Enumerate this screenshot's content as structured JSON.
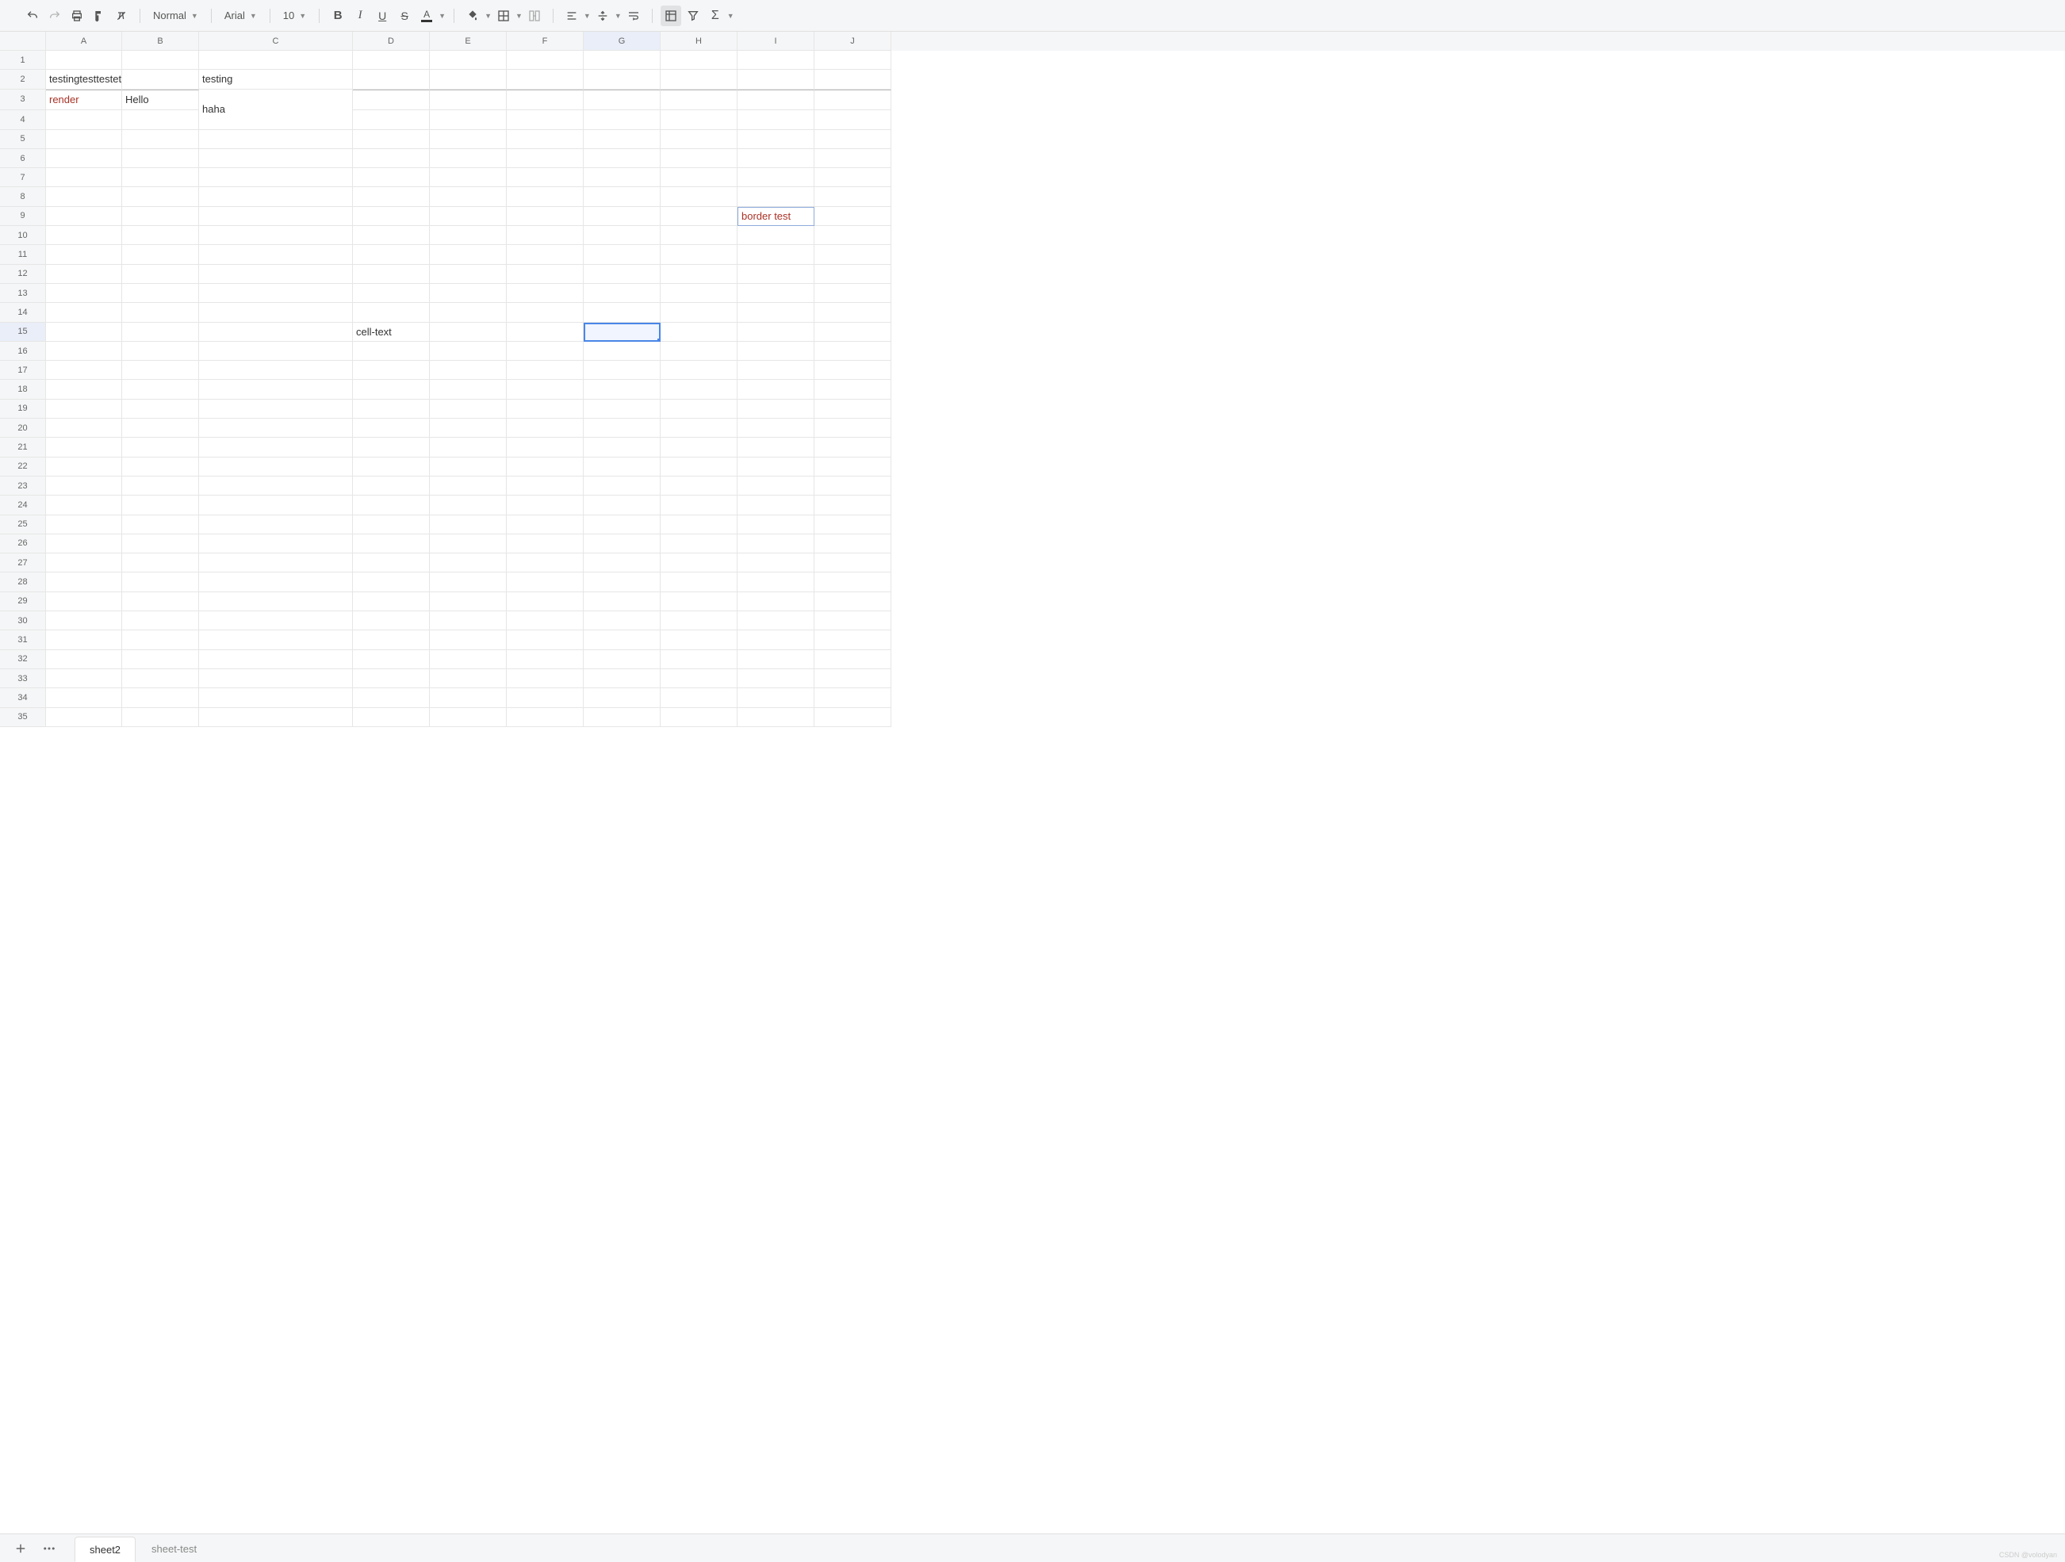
{
  "toolbar": {
    "format_select": "Normal",
    "font_select": "Arial",
    "size_select": "10"
  },
  "columns": [
    {
      "label": "A",
      "width": 96
    },
    {
      "label": "B",
      "width": 97
    },
    {
      "label": "C",
      "width": 194
    },
    {
      "label": "D",
      "width": 97
    },
    {
      "label": "E",
      "width": 97
    },
    {
      "label": "F",
      "width": 97
    },
    {
      "label": "G",
      "width": 97
    },
    {
      "label": "H",
      "width": 97
    },
    {
      "label": "I",
      "width": 97
    },
    {
      "label": "J",
      "width": 97
    }
  ],
  "row_height_default": 24.3,
  "row_heights_override": {
    "3": 26,
    "4": 25
  },
  "num_rows": 35,
  "cells": {
    "A2": {
      "text": "testingtesttestets"
    },
    "C2": {
      "text": "testing"
    },
    "A3": {
      "text": "render",
      "style": "red"
    },
    "B3": {
      "text": "Hello"
    },
    "D15": {
      "text": "cell-text"
    },
    "I9": {
      "text": "border test",
      "style": "bordered"
    }
  },
  "merged_cells": [
    {
      "text": "haha",
      "top_row": 3,
      "left_col": "C",
      "row_span": 2,
      "col_span": 1
    }
  ],
  "selection": "G15",
  "selected_col": "G",
  "selected_row": 15,
  "sheets": [
    {
      "name": "sheet2",
      "active": true
    },
    {
      "name": "sheet-test",
      "active": false
    }
  ],
  "watermark": "CSDN @volodyan"
}
